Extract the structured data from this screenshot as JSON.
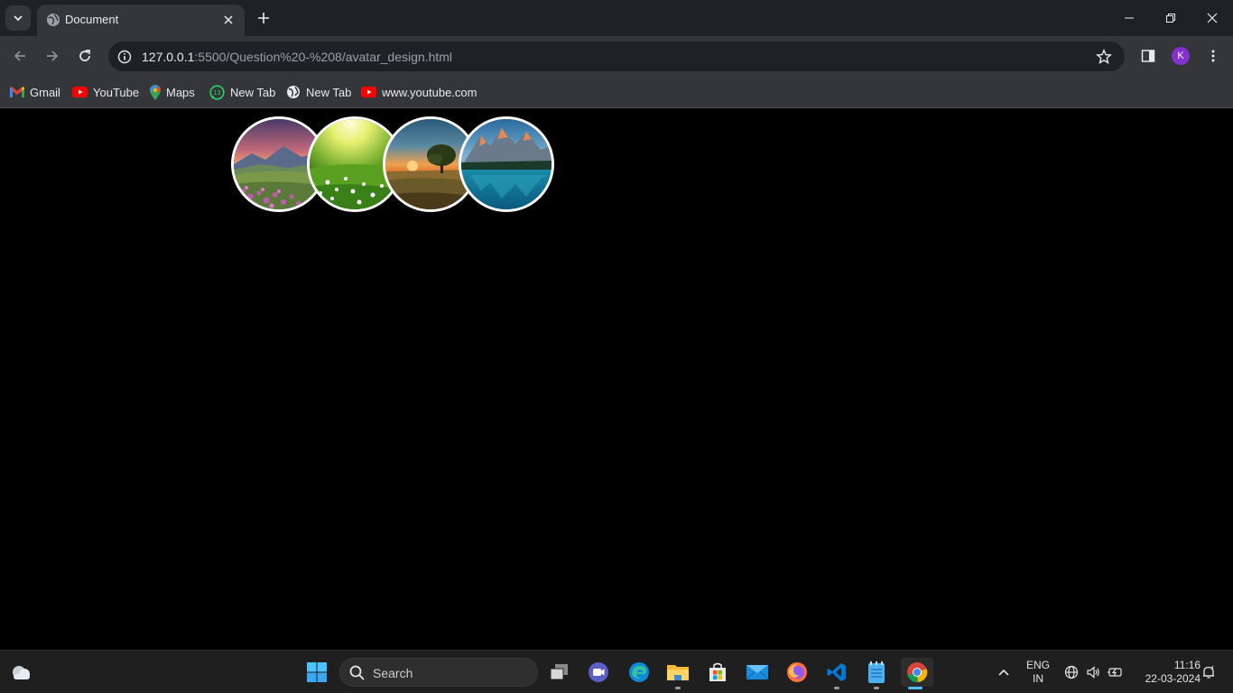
{
  "browser": {
    "tab_title": "Document",
    "url_host": "127.0.0.1",
    "url_rest": ":5500/Question%20-%208/avatar_design.html",
    "profile_initial": "K",
    "bookmarks": [
      {
        "label": "Gmail",
        "icon": "gmail-icon"
      },
      {
        "label": "YouTube",
        "icon": "youtube-icon"
      },
      {
        "label": "Maps",
        "icon": "maps-icon"
      },
      {
        "label": "New Tab",
        "icon": "whatsapp-icon",
        "badge": "13"
      },
      {
        "label": "New Tab",
        "icon": "globe-icon"
      },
      {
        "label": "www.youtube.com",
        "icon": "youtube-icon"
      }
    ]
  },
  "avatars": [
    {
      "name": "mountain-flower-meadow-avatar",
      "scene": "mountain meadow with pink flowers at sunset"
    },
    {
      "name": "sunlit-grass-field-avatar",
      "scene": "sunlit green grass with white flowers"
    },
    {
      "name": "sunset-tree-avatar",
      "scene": "lone tree in field at sunset"
    },
    {
      "name": "mountain-lake-avatar",
      "scene": "turquoise mountain lake with reflections"
    }
  ],
  "taskbar": {
    "search_placeholder": "Search",
    "language": "ENG",
    "region": "IN",
    "time": "11:16",
    "date": "22-03-2024"
  },
  "colors": {
    "chrome_dark": "#202124",
    "chrome_toolbar": "#35363a",
    "page_background": "#000000",
    "profile_accent": "#8430ce",
    "taskbar": "#1f1f1f"
  }
}
